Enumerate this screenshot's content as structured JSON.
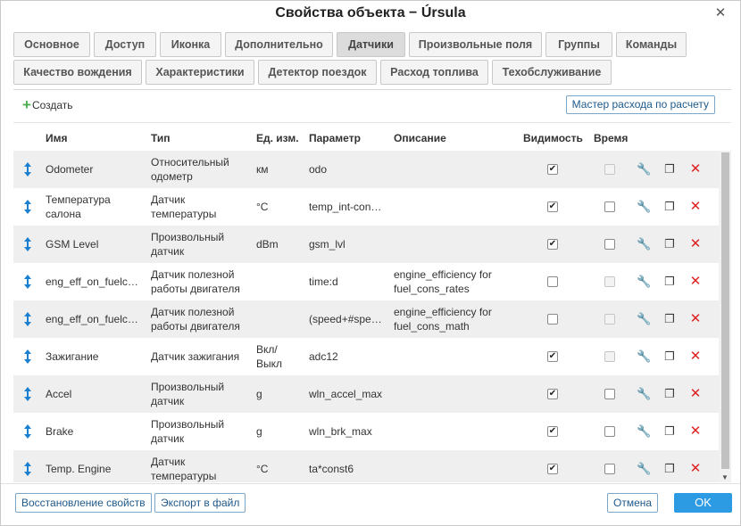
{
  "window": {
    "title": "Свойства объекта − Úrsula",
    "close_icon": "close-icon"
  },
  "tabs_row1": [
    "Основное",
    "Доступ",
    "Иконка",
    "Дополнительно",
    "Датчики",
    "Произвольные поля",
    "Группы",
    "Команды"
  ],
  "tabs_row2": [
    "Качество вождения",
    "Характеристики",
    "Детектор поездок",
    "Расход топлива",
    "Техобслуживание"
  ],
  "active_tab": "Датчики",
  "toolbar": {
    "create_label": "Создать",
    "master_label": "Мастер расхода по расчету"
  },
  "columns": {
    "name": "Имя",
    "type": "Тип",
    "unit": "Ед. изм.",
    "param": "Параметр",
    "desc": "Описание",
    "visible": "Видимость",
    "time": "Время"
  },
  "sensors": [
    {
      "name": "Odometer",
      "type": "Относительный одометр",
      "unit": "км",
      "param": "odo",
      "desc": "",
      "visible": true,
      "time": false,
      "time_enabled": false
    },
    {
      "name": "Температура салона",
      "type": "Датчик температуры",
      "unit": "°C",
      "param": "temp_int-con…",
      "desc": "",
      "visible": true,
      "time": false,
      "time_enabled": true
    },
    {
      "name": "GSM Level",
      "type": "Произвольный датчик",
      "unit": "dBm",
      "param": "gsm_lvl",
      "desc": "",
      "visible": true,
      "time": false,
      "time_enabled": true
    },
    {
      "name": "eng_eff_on_fuelc…",
      "type": "Датчик полезной работы двигателя",
      "unit": "",
      "param": "time:d",
      "desc": "engine_efficiency for fuel_cons_rates",
      "visible": false,
      "time": false,
      "time_enabled": false
    },
    {
      "name": "eng_eff_on_fuelc…",
      "type": "Датчик полезной работы двигателя",
      "unit": "",
      "param": "(speed+#spe…",
      "desc": "engine_efficiency for fuel_cons_math",
      "visible": false,
      "time": false,
      "time_enabled": false
    },
    {
      "name": "Зажигание",
      "type": "Датчик зажигания",
      "unit": "Вкл/ Выкл",
      "param": "adc12",
      "desc": "",
      "visible": true,
      "time": false,
      "time_enabled": false
    },
    {
      "name": "Accel",
      "type": "Произвольный датчик",
      "unit": "g",
      "param": "wln_accel_max",
      "desc": "",
      "visible": true,
      "time": false,
      "time_enabled": true
    },
    {
      "name": "Brake",
      "type": "Произвольный датчик",
      "unit": "g",
      "param": "wln_brk_max",
      "desc": "",
      "visible": true,
      "time": false,
      "time_enabled": true
    },
    {
      "name": "Temp. Engine",
      "type": "Датчик температуры",
      "unit": "°C",
      "param": "ta*const6",
      "desc": "",
      "visible": true,
      "time": false,
      "time_enabled": true
    }
  ],
  "footer": {
    "restore_label": "Восстановление свойств",
    "export_label": "Экспорт в файл",
    "cancel_label": "Отмена",
    "ok_label": "OK"
  },
  "colors": {
    "accent": "#2d9be4",
    "link": "#1f5a8a",
    "delete": "#e02020",
    "create_plus": "#4caf50",
    "row_stripe": "#efefef"
  }
}
